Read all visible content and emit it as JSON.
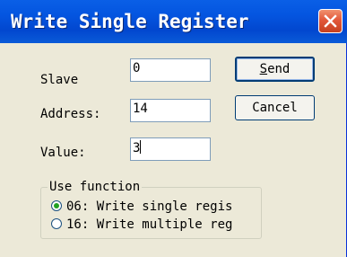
{
  "window": {
    "title": "Write Single Register"
  },
  "fields": {
    "slave": {
      "label": "Slave",
      "value": "0"
    },
    "address": {
      "label": "Address:",
      "value": "14"
    },
    "value": {
      "label": "Value:",
      "value": "3"
    }
  },
  "buttons": {
    "send_underlined": "S",
    "send_rest": "end",
    "cancel": "Cancel"
  },
  "function_group": {
    "label": "Use function",
    "options": [
      {
        "label": "06: Write single regis",
        "selected": true
      },
      {
        "label": "16: Write multiple reg",
        "selected": false
      }
    ]
  },
  "colors": {
    "titlebar": "#0455e0",
    "close": "#e2583a",
    "face": "#ece9d8"
  }
}
